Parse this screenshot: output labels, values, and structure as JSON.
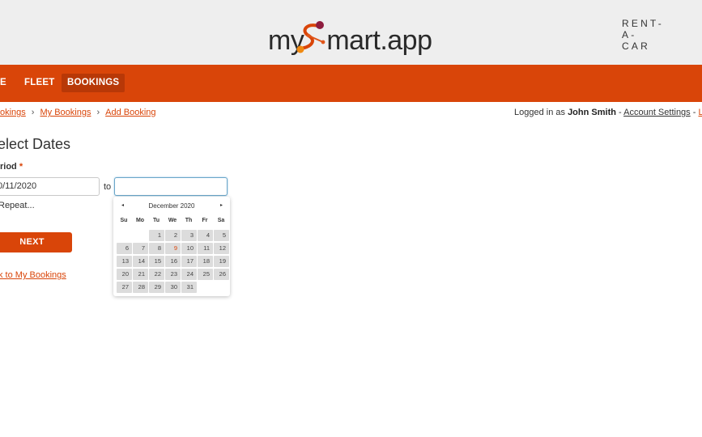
{
  "header": {
    "logo_small": "RENT-A-CAR",
    "logo_my": "my",
    "logo_rest": "mart.app"
  },
  "nav": [
    {
      "label": "E"
    },
    {
      "label": "FLEET"
    },
    {
      "label": "BOOKINGS",
      "active": true
    }
  ],
  "breadcrumb": {
    "item0": "okings",
    "item1": "My Bookings",
    "item2": "Add Booking",
    "separator": "›"
  },
  "login": {
    "prefix": "Logged in as ",
    "user": "John Smith",
    "dash1": " - ",
    "account": "Account Settings",
    "dash2": " - ",
    "logout": "Lo"
  },
  "form": {
    "title": "elect Dates",
    "period_label": "riod",
    "required_mark": "*",
    "start_value": "0/11/2020",
    "to_label": "to",
    "end_value": "",
    "repeat_label": "Repeat...",
    "next_label": "NEXT",
    "back_link": "k to My Bookings"
  },
  "datepicker": {
    "prev_icon": "◂",
    "next_icon": "▸",
    "month_label": "December 2020",
    "weekdays": [
      "Su",
      "Mo",
      "Tu",
      "We",
      "Th",
      "Fr",
      "Sa"
    ],
    "days": [
      "1",
      "2",
      "3",
      "4",
      "5",
      "6",
      "7",
      "8",
      "9",
      "10",
      "11",
      "12",
      "13",
      "14",
      "15",
      "16",
      "17",
      "18",
      "19",
      "20",
      "21",
      "22",
      "23",
      "24",
      "25",
      "26",
      "27",
      "28",
      "29",
      "30",
      "31"
    ],
    "today": "9",
    "accent_color": "#d94509"
  }
}
